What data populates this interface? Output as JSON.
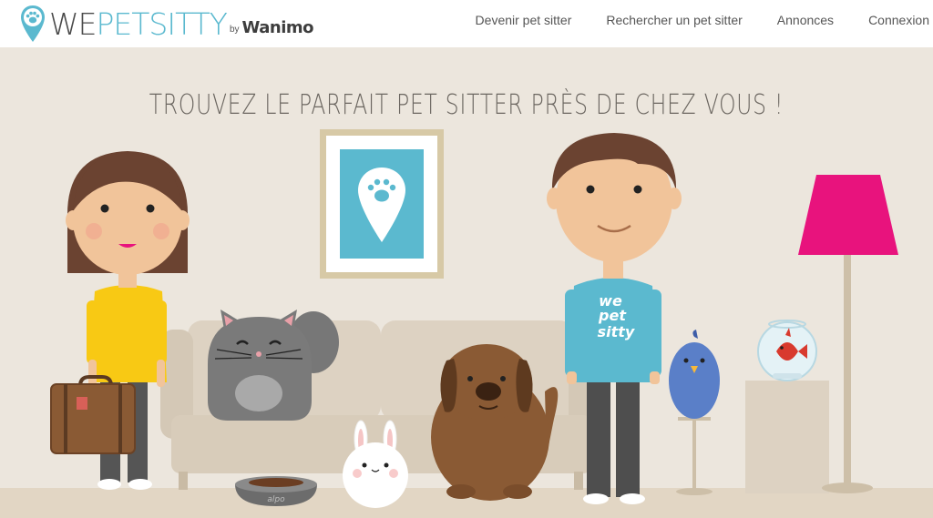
{
  "header": {
    "logo": {
      "part_we": "WE",
      "part_petsitty": "PETSITTY",
      "by": "by",
      "wanimo": "Wanimo"
    },
    "nav": [
      {
        "label": "Devenir pet sitter"
      },
      {
        "label": "Rechercher un pet sitter"
      },
      {
        "label": "Annonces"
      },
      {
        "label": "Connexion"
      }
    ]
  },
  "hero": {
    "title": "TROUVEZ LE PARFAIT PET SITTER PRÈS DE CHEZ VOUS !",
    "shirt_text": [
      "we",
      "pet",
      "sitty"
    ],
    "bowl_text": "alpo"
  },
  "colors": {
    "brand_blue": "#5bb9cf",
    "background": "#ece6dd",
    "lamp_pink": "#e8137d",
    "shirt_yellow": "#f8c914",
    "shirt_blue": "#5bb9cf"
  },
  "icons": [
    "paw-pin-icon"
  ]
}
